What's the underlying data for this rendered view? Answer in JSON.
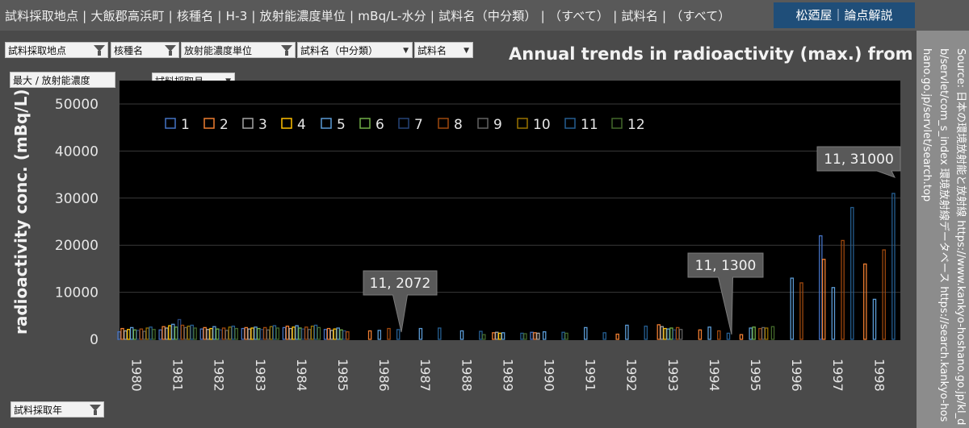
{
  "filter_bar": {
    "items": [
      "試料採取地点",
      "大飯郡高浜町",
      "核種名",
      "H-3",
      "放射能濃度単位",
      "mBq/L-水分",
      "試料名（中分類）",
      "（すべて）",
      "試料名",
      "（すべて）"
    ]
  },
  "brand": {
    "label": "松廼屋｜論点解説"
  },
  "slicers": {
    "site": "試料採取地点",
    "nuclide": "核種名",
    "unit": "放射能濃度単位",
    "sample_mid": "試料名（中分類）",
    "sample": "試料名",
    "value_field": "最大 / 放射能濃度",
    "month": "試料採取月",
    "year": "試料採取年"
  },
  "source": {
    "text": "Source: 日本の環境放射能と放射線 https://www.kankyo-hoshano.go.jp/kl_db/servlet/com_s_index 環境放射線データベース https://search.kankyo-hoshano.go.jp/servlet/search.top"
  },
  "colors": {
    "background": "#000000",
    "panel": "#4a4a4a",
    "grid": "#3a3a3a",
    "months": [
      "#4472c4",
      "#ed7d31",
      "#a5a5a5",
      "#ffc000",
      "#5b9bd5",
      "#70ad47",
      "#264478",
      "#9e480e",
      "#636363",
      "#997300",
      "#255e91",
      "#43682b"
    ]
  },
  "chart_data": {
    "type": "bar",
    "title": "Annual trends in radioactivity (max.) from air",
    "xlabel": "",
    "ylabel": "radioactivity conc. (mBq/L)",
    "ylim": [
      0,
      52000
    ],
    "yticks": [
      0,
      10000,
      20000,
      30000,
      40000,
      50000
    ],
    "grid": true,
    "legend_position": "top-left",
    "series_names": [
      "1",
      "2",
      "3",
      "4",
      "5",
      "6",
      "7",
      "8",
      "9",
      "10",
      "11",
      "12"
    ],
    "categories": [
      "1980",
      "1981",
      "1982",
      "1983",
      "1984",
      "1985",
      "1986",
      "1987",
      "1988",
      "1989",
      "1990",
      "1991",
      "1992",
      "1993",
      "1994",
      "1995",
      "1996",
      "1997",
      "1998"
    ],
    "groups": [
      {
        "year": "1980",
        "bars": [
          [
            1,
            1600
          ],
          [
            2,
            2300
          ],
          [
            3,
            1800
          ],
          [
            4,
            2100
          ],
          [
            5,
            2500
          ],
          [
            6,
            2000
          ],
          [
            7,
            1900
          ],
          [
            8,
            2200
          ],
          [
            9,
            1700
          ],
          [
            10,
            2400
          ],
          [
            11,
            2600
          ],
          [
            12,
            2100
          ]
        ]
      },
      {
        "year": "1981",
        "bars": [
          [
            1,
            2000
          ],
          [
            2,
            2700
          ],
          [
            3,
            2400
          ],
          [
            4,
            2900
          ],
          [
            5,
            3200
          ],
          [
            6,
            2600
          ],
          [
            7,
            4200
          ],
          [
            8,
            3000
          ],
          [
            9,
            2500
          ],
          [
            10,
            2800
          ],
          [
            11,
            3000
          ],
          [
            12,
            2400
          ]
        ]
      },
      {
        "year": "1982",
        "bars": [
          [
            1,
            2200
          ],
          [
            2,
            2500
          ],
          [
            3,
            2100
          ],
          [
            4,
            2300
          ],
          [
            5,
            2700
          ],
          [
            6,
            2200
          ],
          [
            7,
            2000
          ],
          [
            8,
            2400
          ],
          [
            9,
            1900
          ],
          [
            10,
            2600
          ],
          [
            11,
            2800
          ],
          [
            12,
            2300
          ]
        ]
      },
      {
        "year": "1983",
        "bars": [
          [
            1,
            2300
          ],
          [
            2,
            2500
          ],
          [
            3,
            2200
          ],
          [
            4,
            2400
          ],
          [
            5,
            2600
          ],
          [
            6,
            2300
          ],
          [
            7,
            2100
          ],
          [
            8,
            2500
          ],
          [
            9,
            2000
          ],
          [
            10,
            2700
          ],
          [
            11,
            2900
          ],
          [
            12,
            2400
          ]
        ]
      },
      {
        "year": "1984",
        "bars": [
          [
            1,
            2500
          ],
          [
            2,
            2800
          ],
          [
            3,
            2300
          ],
          [
            4,
            2600
          ],
          [
            5,
            2900
          ],
          [
            6,
            2400
          ],
          [
            7,
            2200
          ],
          [
            8,
            2600
          ],
          [
            9,
            2100
          ],
          [
            10,
            2800
          ],
          [
            11,
            3000
          ],
          [
            12,
            2500
          ]
        ]
      },
      {
        "year": "1985",
        "bars": [
          [
            1,
            2100
          ],
          [
            2,
            2300
          ],
          [
            3,
            1900
          ],
          [
            4,
            2200
          ],
          [
            5,
            2400
          ],
          [
            6,
            2000
          ],
          [
            7,
            1800
          ],
          [
            8,
            1600
          ]
        ]
      },
      {
        "year": "1986",
        "bars": [
          [
            2,
            1800
          ],
          [
            5,
            1900
          ],
          [
            8,
            2300
          ],
          [
            11,
            2072
          ]
        ]
      },
      {
        "year": "1987",
        "bars": [
          [
            5,
            2300
          ],
          [
            11,
            2400
          ]
        ]
      },
      {
        "year": "1988",
        "bars": [
          [
            5,
            1800
          ],
          [
            11,
            1700
          ],
          [
            12,
            1000
          ]
        ]
      },
      {
        "year": "1989",
        "bars": [
          [
            2,
            1400
          ],
          [
            3,
            1500
          ],
          [
            4,
            1300
          ],
          [
            5,
            1400
          ],
          [
            11,
            1300
          ],
          [
            12,
            1200
          ]
        ]
      },
      {
        "year": "1990",
        "bars": [
          [
            1,
            1500
          ],
          [
            2,
            1400
          ],
          [
            3,
            1300
          ],
          [
            5,
            1600
          ],
          [
            11,
            1500
          ],
          [
            12,
            1300
          ]
        ]
      },
      {
        "year": "1991",
        "bars": [
          [
            5,
            2500
          ],
          [
            11,
            1400
          ]
        ]
      },
      {
        "year": "1992",
        "bars": [
          [
            2,
            1100
          ],
          [
            5,
            3000
          ],
          [
            11,
            2800
          ]
        ]
      },
      {
        "year": "1993",
        "bars": [
          [
            2,
            3100
          ],
          [
            3,
            2700
          ],
          [
            4,
            2300
          ],
          [
            5,
            2200
          ],
          [
            6,
            2400
          ],
          [
            7,
            2000
          ],
          [
            8,
            2500
          ],
          [
            9,
            2100
          ]
        ]
      },
      {
        "year": "1994",
        "bars": [
          [
            2,
            2000
          ],
          [
            5,
            2600
          ],
          [
            8,
            1800
          ],
          [
            11,
            1300
          ]
        ]
      },
      {
        "year": "1995",
        "bars": [
          [
            2,
            1000
          ],
          [
            5,
            2400
          ],
          [
            6,
            2600
          ],
          [
            8,
            2300
          ],
          [
            9,
            2500
          ],
          [
            10,
            2400
          ],
          [
            12,
            2700
          ]
        ]
      },
      {
        "year": "1996",
        "bars": [
          [
            5,
            13000
          ],
          [
            8,
            12000
          ]
        ]
      },
      {
        "year": "1997",
        "bars": [
          [
            1,
            22000
          ],
          [
            2,
            17000
          ],
          [
            5,
            11000
          ],
          [
            8,
            21000
          ],
          [
            11,
            28000
          ]
        ]
      },
      {
        "year": "1998",
        "bars": [
          [
            8,
            19000
          ],
          [
            5,
            8500
          ],
          [
            2,
            16000
          ],
          [
            11,
            31000
          ]
        ]
      }
    ],
    "data_labels": [
      {
        "year": "1986",
        "month": 11,
        "text": "11, 2072"
      },
      {
        "year": "1994",
        "month": 11,
        "text": "11, 1300"
      },
      {
        "year": "1998",
        "month": 11,
        "text": "11, 31000"
      }
    ]
  }
}
